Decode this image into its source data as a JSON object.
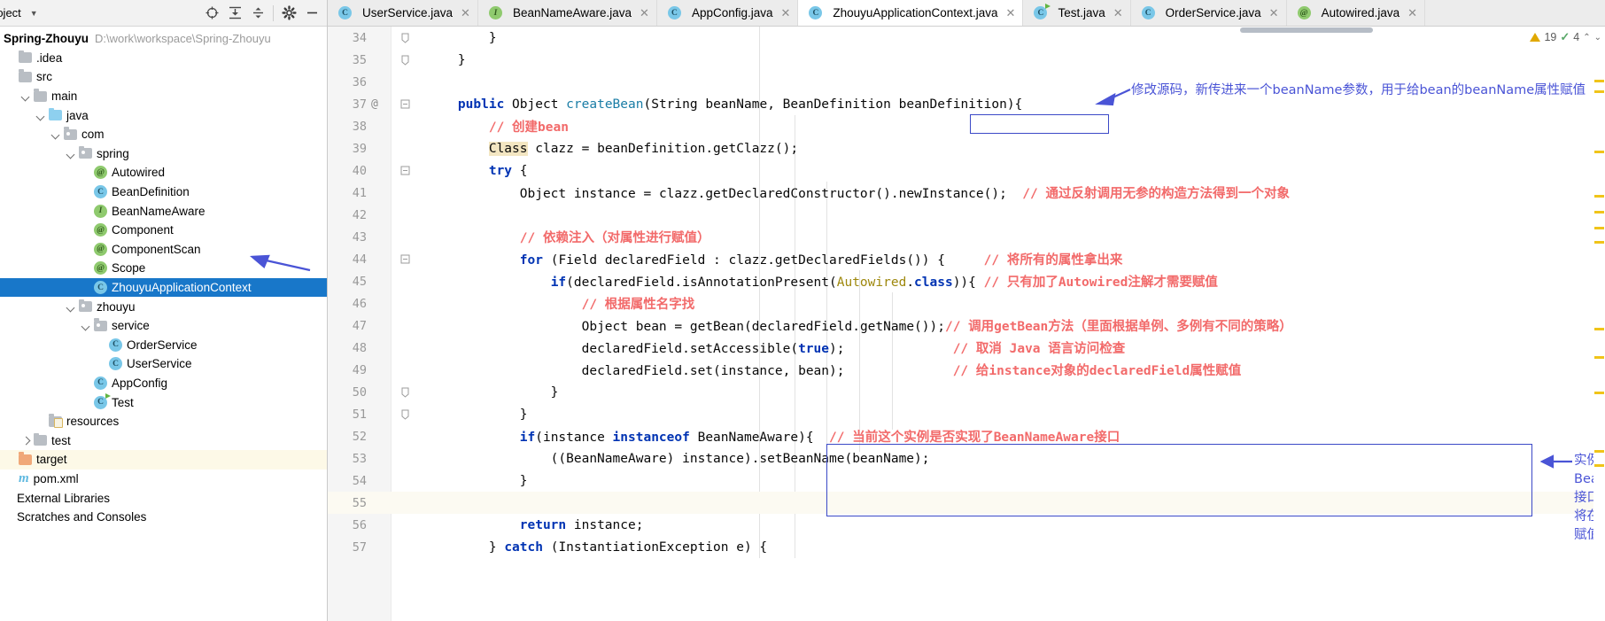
{
  "project_panel": {
    "title": "roject",
    "toolbar_icons": [
      "locate-icon",
      "expand-all-icon",
      "collapse-all-icon",
      "settings-icon",
      "hide-icon"
    ],
    "root": {
      "name": "Spring-Zhouyu",
      "path": "D:\\work\\workspace\\Spring-Zhouyu"
    },
    "items": [
      {
        "label": ".idea",
        "icon": "folder-icon",
        "indent": 1,
        "twisty": "none",
        "selected": false
      },
      {
        "label": "src",
        "icon": "folder-icon",
        "indent": 1,
        "twisty": "none",
        "selected": false
      },
      {
        "label": "main",
        "icon": "folder-icon",
        "indent": 2,
        "twisty": "down",
        "selected": false
      },
      {
        "label": "java",
        "icon": "source-folder-icon",
        "indent": 3,
        "twisty": "down",
        "selected": false
      },
      {
        "label": "com",
        "icon": "package-icon",
        "indent": 4,
        "twisty": "down",
        "selected": false
      },
      {
        "label": "spring",
        "icon": "package-icon",
        "indent": 5,
        "twisty": "down",
        "selected": false
      },
      {
        "label": "Autowired",
        "icon": "annotation-icon",
        "indent": 6,
        "twisty": "none",
        "selected": false
      },
      {
        "label": "BeanDefinition",
        "icon": "class-icon",
        "indent": 6,
        "twisty": "none",
        "selected": false
      },
      {
        "label": "BeanNameAware",
        "icon": "interface-icon",
        "indent": 6,
        "twisty": "none",
        "selected": false
      },
      {
        "label": "Component",
        "icon": "annotation-icon",
        "indent": 6,
        "twisty": "none",
        "selected": false
      },
      {
        "label": "ComponentScan",
        "icon": "annotation-icon",
        "indent": 6,
        "twisty": "none",
        "selected": false
      },
      {
        "label": "Scope",
        "icon": "annotation-icon",
        "indent": 6,
        "twisty": "none",
        "selected": false
      },
      {
        "label": "ZhouyuApplicationContext",
        "icon": "class-icon",
        "indent": 6,
        "twisty": "none",
        "selected": true
      },
      {
        "label": "zhouyu",
        "icon": "package-icon",
        "indent": 5,
        "twisty": "down",
        "selected": false
      },
      {
        "label": "service",
        "icon": "package-icon",
        "indent": 6,
        "twisty": "down",
        "selected": false
      },
      {
        "label": "OrderService",
        "icon": "class-icon",
        "indent": 7,
        "twisty": "none",
        "selected": false
      },
      {
        "label": "UserService",
        "icon": "class-icon",
        "indent": 7,
        "twisty": "none",
        "selected": false
      },
      {
        "label": "AppConfig",
        "icon": "class-icon",
        "indent": 6,
        "twisty": "none",
        "selected": false
      },
      {
        "label": "Test",
        "icon": "runnable-class-icon",
        "indent": 6,
        "twisty": "none",
        "selected": false
      },
      {
        "label": "resources",
        "icon": "resource-folder-icon",
        "indent": 3,
        "twisty": "none",
        "selected": false
      },
      {
        "label": "test",
        "icon": "folder-icon",
        "indent": 2,
        "twisty": "right",
        "selected": false
      },
      {
        "label": "target",
        "icon": "excluded-folder-icon",
        "indent": 1,
        "twisty": "none",
        "selected": false,
        "modified": true
      },
      {
        "label": "pom.xml",
        "icon": "maven-icon",
        "indent": 1,
        "twisty": "none",
        "selected": false
      },
      {
        "label": "External Libraries",
        "icon": "none",
        "indent": 0,
        "twisty": "none",
        "selected": false
      },
      {
        "label": "Scratches and Consoles",
        "icon": "none",
        "indent": 0,
        "twisty": "none",
        "selected": false
      }
    ]
  },
  "tabs": [
    {
      "label": "UserService.java",
      "icon": "class-icon",
      "active": false
    },
    {
      "label": "BeanNameAware.java",
      "icon": "interface-icon",
      "active": false
    },
    {
      "label": "AppConfig.java",
      "icon": "class-icon",
      "active": false
    },
    {
      "label": "ZhouyuApplicationContext.java",
      "icon": "class-icon",
      "active": true
    },
    {
      "label": "Test.java",
      "icon": "runnable-class-icon",
      "active": false
    },
    {
      "label": "OrderService.java",
      "icon": "class-icon",
      "active": false
    },
    {
      "label": "Autowired.java",
      "icon": "annotation-icon",
      "active": false
    }
  ],
  "inspections": {
    "warnings": "19",
    "checks": "4"
  },
  "editor": {
    "lines": [
      {
        "num": "34",
        "fold": "end",
        "at": false,
        "text": "        }"
      },
      {
        "num": "35",
        "fold": "end2",
        "at": false,
        "text": "    }"
      },
      {
        "num": "36",
        "fold": "none",
        "at": false,
        "text": ""
      },
      {
        "num": "37",
        "fold": "start",
        "at": true,
        "text": "    public Object createBean(String beanName, BeanDefinition beanDefinition){"
      },
      {
        "num": "38",
        "fold": "none",
        "at": false,
        "text": "        // 创建bean"
      },
      {
        "num": "39",
        "fold": "none",
        "at": false,
        "text": "        Class clazz = beanDefinition.getClazz();"
      },
      {
        "num": "40",
        "fold": "start",
        "at": false,
        "text": "        try {"
      },
      {
        "num": "41",
        "fold": "none",
        "at": false,
        "text": "            Object instance = clazz.getDeclaredConstructor().newInstance();  // 通过反射调用无参的构造方法得到一个对象"
      },
      {
        "num": "42",
        "fold": "none",
        "at": false,
        "text": ""
      },
      {
        "num": "43",
        "fold": "none",
        "at": false,
        "text": "            // 依赖注入（对属性进行赋值）"
      },
      {
        "num": "44",
        "fold": "start",
        "at": false,
        "text": "            for (Field declaredField : clazz.getDeclaredFields()) {     // 将所有的属性拿出来"
      },
      {
        "num": "45",
        "fold": "none",
        "at": false,
        "text": "                if(declaredField.isAnnotationPresent(Autowired.class)){ // 只有加了Autowired注解才需要赋值"
      },
      {
        "num": "46",
        "fold": "none",
        "at": false,
        "text": "                    // 根据属性名字找"
      },
      {
        "num": "47",
        "fold": "none",
        "at": false,
        "text": "                    Object bean = getBean(declaredField.getName());// 调用getBean方法（里面根据单例、多例有不同的策略）"
      },
      {
        "num": "48",
        "fold": "none",
        "at": false,
        "text": "                    declaredField.setAccessible(true);              // 取消 Java 语言访问检查"
      },
      {
        "num": "49",
        "fold": "none",
        "at": false,
        "text": "                    declaredField.set(instance, bean);              // 给instance对象的declaredField属性赋值"
      },
      {
        "num": "50",
        "fold": "end",
        "at": false,
        "text": "                }"
      },
      {
        "num": "51",
        "fold": "end",
        "at": false,
        "text": "            }"
      },
      {
        "num": "52",
        "fold": "none",
        "at": false,
        "text": "            if(instance instanceof BeanNameAware){  // 当前这个实例是否实现了BeanNameAware接口"
      },
      {
        "num": "53",
        "fold": "none",
        "at": false,
        "text": "                ((BeanNameAware) instance).setBeanName(beanName);"
      },
      {
        "num": "54",
        "fold": "none",
        "at": false,
        "text": "            }"
      },
      {
        "num": "55",
        "fold": "none",
        "at": false,
        "text": ""
      },
      {
        "num": "56",
        "fold": "none",
        "at": false,
        "text": "            return instance;"
      },
      {
        "num": "57",
        "fold": "none",
        "at": false,
        "text": "        } catch (InstantiationException e) {"
      }
    ]
  },
  "annotations": {
    "top_note": "修改源码，新传进来一个beanName参数，用于给bean的beanName属性赋值",
    "side_note": "实例实现了\nBeanNameAware\n接口，就调用方法\n将在工厂中的名字\n赋值给beanName属性",
    "tree_arrow": "tree-pointer-arrow",
    "color": "#4a54d6"
  }
}
